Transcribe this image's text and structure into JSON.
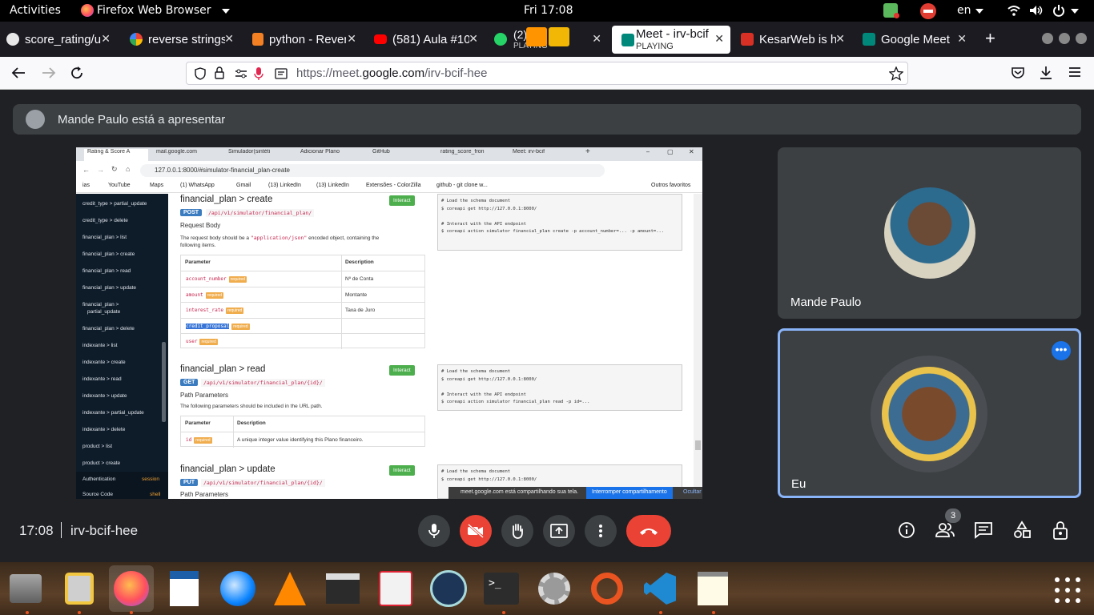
{
  "top_bar": {
    "activities": "Activities",
    "app_name": "Firefox Web Browser",
    "clock": "Fri 17:08",
    "language": "en"
  },
  "tabs": [
    {
      "label": "score_rating/u",
      "favicon": "github-icon",
      "color": "#e8e8e8"
    },
    {
      "label": "reverse strings",
      "favicon": "google-icon",
      "color": "#ea4335"
    },
    {
      "label": "python - Rever",
      "favicon": "stackoverflow-icon",
      "color": "#f48024"
    },
    {
      "label": "(581) Aula #10",
      "favicon": "youtube-icon",
      "color": "#ff0000"
    },
    {
      "label": "(2) App",
      "sublabel": "PLAYING",
      "favicon": "whatsapp-icon",
      "color": "#25d366"
    },
    {
      "label": "Meet - irv-bcif",
      "sublabel": "PLAYING",
      "favicon": "meet-icon",
      "color": "#00897b"
    },
    {
      "label": "KesarWeb is hi",
      "favicon": "gmail-icon",
      "color": "#d93025"
    },
    {
      "label": "Google Meet",
      "favicon": "meet-icon",
      "color": "#00897b"
    }
  ],
  "navigation": {
    "url_prefix": "https://meet.",
    "url_domain": "google.com",
    "url_path": "/irv-bcif-hee"
  },
  "meet": {
    "presenting_banner": "Mande Paulo está a apresentar",
    "tiles": [
      {
        "name": "Mande Paulo"
      },
      {
        "name": "Eu"
      }
    ],
    "time": "17:08",
    "meeting_code": "irv-bcif-hee",
    "participants_count": "3"
  },
  "shared_screen": {
    "browser_tabs": [
      "Rating & Score A",
      "mail.google.com",
      "Simulador(sintéti",
      "Adicionar Plano",
      "GitHub",
      "rating_score_fron",
      "Meet: irv-bcif"
    ],
    "url": "127.0.0.1:8000/#simulator-financial_plan-create",
    "bookmarks": [
      "ias",
      "YouTube",
      "Maps",
      "(1) WhatsApp",
      "Gmail",
      "(13) LinkedIn",
      "(13) LinkedIn",
      "Extensões - ColorZilla",
      "github - git clone w...",
      "Outros favoritos"
    ],
    "sidebar": [
      "credit_type > partial_update",
      "credit_type > delete",
      "financial_plan > list",
      "financial_plan > create",
      "financial_plan > read",
      "financial_plan > update",
      "financial_plan >",
      "partial_update",
      "financial_plan > delete",
      "indexante > list",
      "indexante > create",
      "indexante > read",
      "indexante > update",
      "indexante > partial_update",
      "indexante > delete",
      "product > list",
      "product > create"
    ],
    "sidebar_footer": {
      "auth": "Authentication",
      "auth_val": "session",
      "source": "Source Code",
      "source_val": "shell"
    },
    "create": {
      "title": "financial_plan > create",
      "method": "POST",
      "path": "/api/v1/simulator/financial_plan/",
      "section": "Request Body",
      "desc1": "The request body should be a",
      "desc_code": "\"application/json\"",
      "desc2": "encoded object, containing the",
      "desc3": "following items.",
      "col_param": "Parameter",
      "col_desc": "Description",
      "rows": [
        {
          "name": "account_number",
          "req": "required",
          "desc": "Nº de Conta"
        },
        {
          "name": "amount",
          "req": "required",
          "desc": "Montante"
        },
        {
          "name": "interest_rate",
          "req": "required",
          "desc": "Taxa de Juro"
        },
        {
          "name": "credit_proposal",
          "req": "required",
          "desc": ""
        },
        {
          "name": "user",
          "req": "required",
          "desc": ""
        }
      ],
      "code": "# Load the schema document\n$ coreapi get http://127.0.0.1:8000/\n\n# Interact with the API endpoint\n$ coreapi action simulator financial_plan create -p account_number=... -p amount=..."
    },
    "read": {
      "title": "financial_plan > read",
      "method": "GET",
      "path": "/api/v1/simulator/financial_plan/{id}/",
      "section": "Path Parameters",
      "desc": "The following parameters should be included in the URL path.",
      "col_param": "Parameter",
      "col_desc": "Description",
      "row_name": "id",
      "row_req": "required",
      "row_desc": "A unique integer value identifying this Plano financeiro.",
      "code": "# Load the schema document\n$ coreapi get http://127.0.0.1:8000/\n\n# Interact with the API endpoint\n$ coreapi action simulator financial_plan read -p id=..."
    },
    "update": {
      "title": "financial_plan > update",
      "method": "PUT",
      "path": "/api/v1/simulator/financial_plan/{id}/",
      "section": "Path Parameters",
      "code": "# Load the schema document\n$ coreapi get http://127.0.0.1:8000/"
    },
    "interact_label": "Interact",
    "notification": "meet.google.com está compartilhando sua tela.",
    "stop_sharing": "Interromper compartilhamento",
    "hide": "Ocultar"
  }
}
